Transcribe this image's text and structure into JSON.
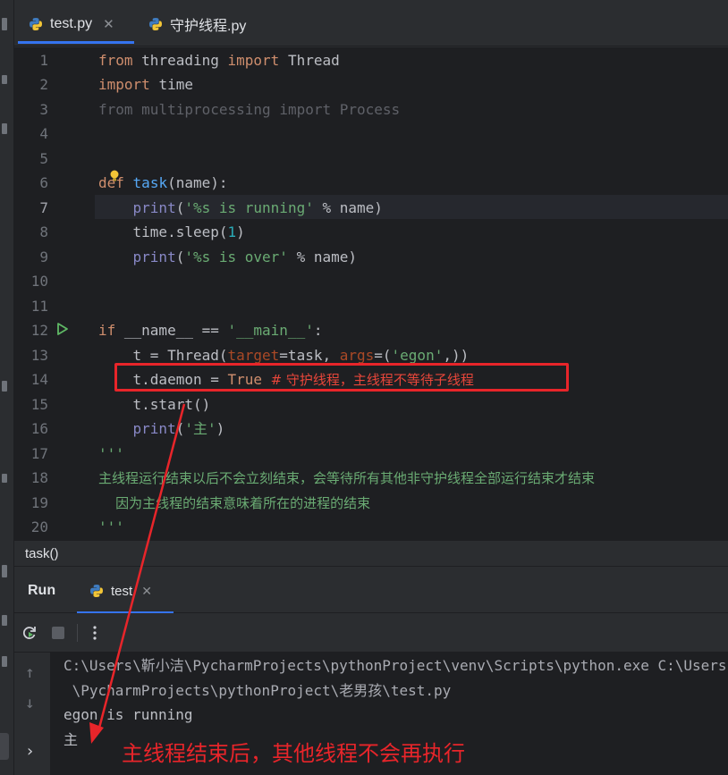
{
  "tabs": [
    {
      "label": "test.py",
      "active": true,
      "closable": true
    },
    {
      "label": "守护线程.py",
      "active": false,
      "closable": false
    }
  ],
  "editor": {
    "line_numbers": [
      "1",
      "2",
      "3",
      "4",
      "5",
      "6",
      "7",
      "8",
      "9",
      "10",
      "11",
      "12",
      "13",
      "14",
      "15",
      "16",
      "17",
      "18",
      "19",
      "20"
    ],
    "current_line": "7",
    "lines": {
      "l1": {
        "kw1": "from",
        "mod": "threading",
        "kw2": "import",
        "name": "Thread"
      },
      "l2": {
        "kw": "import",
        "mod": "time"
      },
      "l3": {
        "kw1": "from",
        "mod": "multiprocessing",
        "kw2": "import",
        "name": "Process"
      },
      "l6": {
        "kw": "def",
        "fn": "task",
        "p1": "(",
        "param": "name",
        "p2": "):"
      },
      "l7": {
        "fn": "print",
        "p1": "(",
        "str": "'%s is running'",
        "op": " % ",
        "var": "name",
        "p2": ")"
      },
      "l8": {
        "obj": "time.sleep(",
        "num": "1",
        "p2": ")"
      },
      "l9": {
        "fn": "print",
        "p1": "(",
        "str": "'%s is over'",
        "op": " % ",
        "var": "name",
        "p2": ")"
      },
      "l12": {
        "kw": "if",
        "name": " __name__ == ",
        "str": "'__main__'",
        "p2": ":"
      },
      "l13": {
        "pre": "t = Thread(",
        "k1": "target",
        "mid": "=task, ",
        "k2": "args",
        "eq": "=(",
        "str": "'egon'",
        "post": ",))"
      },
      "l14": {
        "pre": "t.daemon = ",
        "kw": "True",
        "cmt": "  # 守护线程，主线程不等待子线程"
      },
      "l15": {
        "text": "t.start()"
      },
      "l16": {
        "fn": "print",
        "p1": "(",
        "str": "'主'",
        "p2": ")"
      },
      "l17": {
        "text": "'''"
      },
      "l18": {
        "text": "主线程运行结束以后不会立刻结束，会等待所有其他非守护线程全部运行结束才结束"
      },
      "l19": {
        "text": "    因为主线程的结束意味着所在的进程的结束"
      },
      "l20": {
        "text": "'''"
      }
    }
  },
  "breadcrumb": "task()",
  "run_panel": {
    "title": "Run",
    "tab": "test",
    "console_lines": [
      "C:\\Users\\靳小洁\\PycharmProjects\\pythonProject\\venv\\Scripts\\python.exe C:\\Users",
      " \\PycharmProjects\\pythonProject\\老男孩\\test.py",
      "egon is running",
      "主"
    ]
  },
  "annotation": "主线程结束后，其他线程不会再执行",
  "colors": {
    "accent": "#3574f0",
    "annotation_red": "#e8252a",
    "editor_bg": "#1e1f22",
    "panel_bg": "#2b2d30"
  }
}
